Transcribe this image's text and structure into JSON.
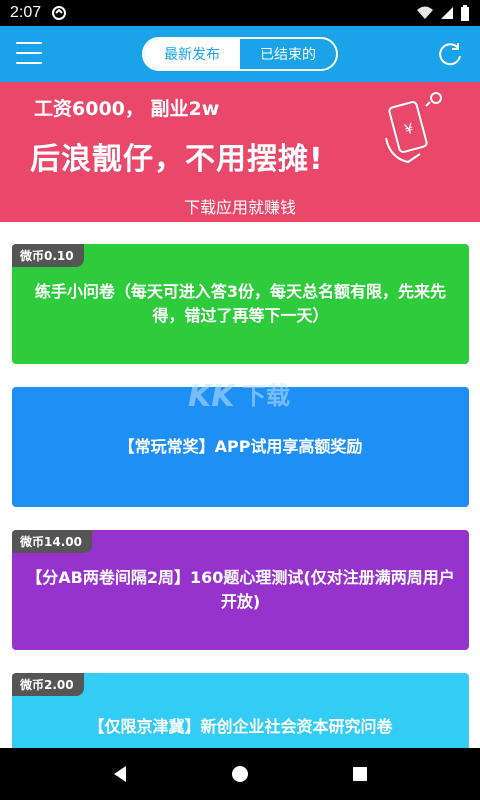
{
  "status_bar": {
    "time": "2:07"
  },
  "header": {
    "tabs": [
      {
        "label": "最新发布",
        "active": true
      },
      {
        "label": "已结束的",
        "active": false
      }
    ],
    "accent_color": "#1aa3e8"
  },
  "banner": {
    "line1": "工资6000， 副业2w",
    "line2": "后浪靓仔，不用摆摊!",
    "line3": "下载应用就赚钱",
    "background": "#e9486a",
    "icon": "phone-money-icon"
  },
  "cards": [
    {
      "badge": "微币0.10",
      "title": "练手小问卷（每天可进入答3份，每天总名额有限，先来先得，错过了再等下一天）",
      "color": "#2ecb3c"
    },
    {
      "badge": "",
      "title": "【常玩常奖】APP试用享高额奖励",
      "color": "#1e90f5"
    },
    {
      "badge": "微币14.00",
      "title": "【分AB两卷间隔2周】160题心理测试(仅对注册满两周用户开放)",
      "color": "#9633cc"
    },
    {
      "badge": "微币2.00",
      "title": "【仅限京津冀】新创企业社会资本研究问卷",
      "color": "#33ccf5"
    }
  ]
}
